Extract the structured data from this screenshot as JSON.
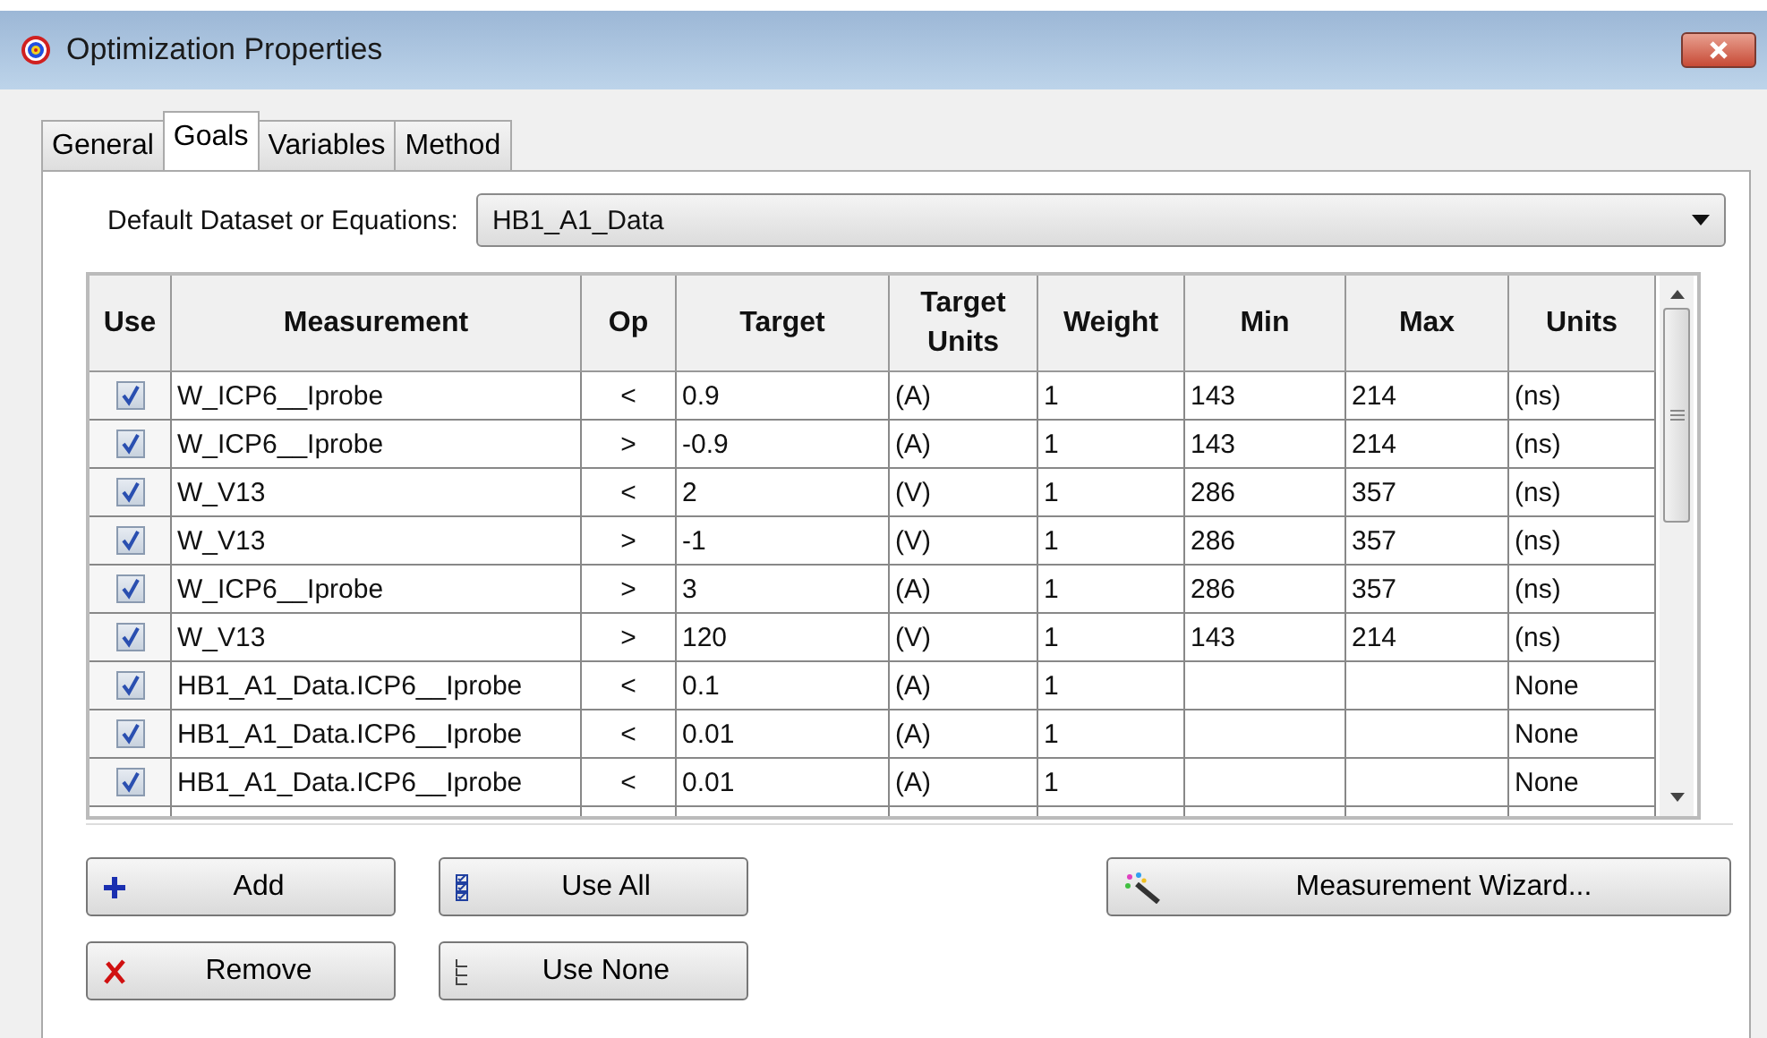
{
  "window": {
    "title": "Optimization Properties"
  },
  "tabs": [
    {
      "label": "General",
      "selected": false
    },
    {
      "label": "Goals",
      "selected": true
    },
    {
      "label": "Variables",
      "selected": false
    },
    {
      "label": "Method",
      "selected": false
    }
  ],
  "dataset": {
    "label": "Default Dataset or Equations:",
    "value": "HB1_A1_Data"
  },
  "table": {
    "columns": [
      "Use",
      "Measurement",
      "Op",
      "Target",
      "Target Units",
      "Weight",
      "Min",
      "Max",
      "Units"
    ],
    "rows": [
      {
        "use": true,
        "measurement": "W_ICP6__Iprobe",
        "op": "<",
        "target": "0.9",
        "target_units": "(A)",
        "weight": "1",
        "min": "143",
        "max": "214",
        "units": "(ns)"
      },
      {
        "use": true,
        "measurement": "W_ICP6__Iprobe",
        "op": ">",
        "target": "-0.9",
        "target_units": "(A)",
        "weight": "1",
        "min": "143",
        "max": "214",
        "units": "(ns)"
      },
      {
        "use": true,
        "measurement": "W_V13",
        "op": "<",
        "target": "2",
        "target_units": "(V)",
        "weight": "1",
        "min": "286",
        "max": "357",
        "units": "(ns)"
      },
      {
        "use": true,
        "measurement": "W_V13",
        "op": ">",
        "target": "-1",
        "target_units": "(V)",
        "weight": "1",
        "min": "286",
        "max": "357",
        "units": "(ns)"
      },
      {
        "use": true,
        "measurement": "W_ICP6__Iprobe",
        "op": ">",
        "target": "3",
        "target_units": "(A)",
        "weight": "1",
        "min": "286",
        "max": "357",
        "units": "(ns)"
      },
      {
        "use": true,
        "measurement": "W_V13",
        "op": ">",
        "target": "120",
        "target_units": "(V)",
        "weight": "1",
        "min": "143",
        "max": "214",
        "units": "(ns)"
      },
      {
        "use": true,
        "measurement": "HB1_A1_Data.ICP6__Iprobe",
        "op": "<",
        "target": "0.1",
        "target_units": "(A)",
        "weight": "1",
        "units": "None"
      },
      {
        "use": true,
        "measurement": "HB1_A1_Data.ICP6__Iprobe",
        "op": "<",
        "target": "0.01",
        "target_units": "(A)",
        "weight": "1",
        "units": "None"
      },
      {
        "use": true,
        "measurement": "HB1_A1_Data.ICP6__Iprobe",
        "op": "<",
        "target": "0.01",
        "target_units": "(A)",
        "weight": "1",
        "units": "None"
      }
    ]
  },
  "buttons": [
    {
      "kind": "add",
      "label": "Add"
    },
    {
      "kind": "use_all",
      "label": "Use All"
    },
    {
      "kind": "wizard",
      "label": "Measurement Wizard..."
    },
    {
      "kind": "remove",
      "label": "Remove"
    },
    {
      "kind": "use_none",
      "label": "Use None"
    }
  ]
}
